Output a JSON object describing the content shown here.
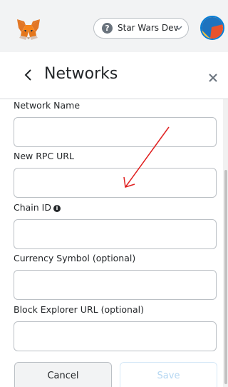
{
  "topbar": {
    "logo_icon": "metamask-fox-icon",
    "network": {
      "label": "Star Wars Dev",
      "icon": "question-icon",
      "chevron": "chevron-down-icon"
    },
    "avatar_icon": "account-identicon"
  },
  "header": {
    "back_icon": "chevron-left-icon",
    "title": "Networks",
    "close_icon": "close-icon"
  },
  "form": {
    "network_name": {
      "label": "Network Name",
      "value": ""
    },
    "rpc_url": {
      "label": "New RPC URL",
      "value": ""
    },
    "chain_id": {
      "label": "Chain ID",
      "value": "",
      "info_icon": "info-icon"
    },
    "currency_symbol": {
      "label": "Currency Symbol (optional)",
      "value": ""
    },
    "block_explorer": {
      "label": "Block Explorer URL (optional)",
      "value": ""
    }
  },
  "buttons": {
    "cancel": "Cancel",
    "save": "Save"
  },
  "colors": {
    "accent": "#037dd6",
    "annotation_arrow": "#e02020",
    "save_disabled": "#b5d7f2"
  }
}
